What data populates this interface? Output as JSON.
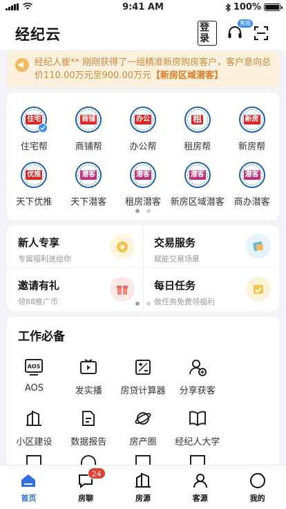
{
  "status_bar": {
    "time": "9:41 AM",
    "battery": "100%"
  },
  "header": {
    "title": "经纪云",
    "login_label": "登录",
    "kefu_badge": "客服"
  },
  "notice": {
    "text_prefix": "经纪人崔** 刚刚获得了一组精准新房购房客户，客户意向总价",
    "price": "110.00万元至900.00万元",
    "highlight": "【新房区域潜客】"
  },
  "services_grid": {
    "items": [
      {
        "label": "住宅帮",
        "logo_text": "住宅",
        "verified": true
      },
      {
        "label": "商铺帮",
        "logo_text": "商铺"
      },
      {
        "label": "办公帮",
        "logo_text": "办公"
      },
      {
        "label": "租房帮",
        "logo_text": "租"
      },
      {
        "label": "新房帮",
        "logo_text": "新房"
      },
      {
        "label": "天下优推",
        "logo_text": "优推"
      },
      {
        "label": "天下潜客",
        "logo_text": "潜客"
      },
      {
        "label": "租房潜客",
        "logo_text": "潜客"
      },
      {
        "label": "新房区域潜客",
        "logo_text": "潜客"
      },
      {
        "label": "商办潜客",
        "logo_text": "潜客"
      }
    ],
    "page_count": 2,
    "active_page": 1
  },
  "promo_tiles": [
    {
      "title": "新人专享",
      "subtitle": "专属福利送给你"
    },
    {
      "title": "交易服务",
      "subtitle": "赋能交易场景"
    },
    {
      "title": "邀请有礼",
      "subtitle": "领88推广币"
    },
    {
      "title": "每日任务",
      "subtitle": "做任务免费领福利"
    }
  ],
  "tools": {
    "title": "工作必备",
    "items": [
      {
        "label": "AOS",
        "icon": "aos-icon"
      },
      {
        "label": "发实播",
        "icon": "video-icon"
      },
      {
        "label": "房贷计算器",
        "icon": "calculator-icon"
      },
      {
        "label": "分享获客",
        "icon": "add-user-icon"
      },
      {
        "label": "小区建设",
        "icon": "building-icon"
      },
      {
        "label": "数据报告",
        "icon": "report-icon"
      },
      {
        "label": "房产圈",
        "icon": "planet-icon"
      },
      {
        "label": "经纪人大学",
        "icon": "book-icon"
      }
    ]
  },
  "tabbar": {
    "tabs": [
      {
        "label": "首页",
        "icon": "home-icon",
        "active": true
      },
      {
        "label": "房聊",
        "icon": "chat-icon",
        "badge": "24"
      },
      {
        "label": "房源",
        "icon": "house-icon"
      },
      {
        "label": "客源",
        "icon": "person-icon"
      },
      {
        "label": "我的",
        "icon": "profile-icon"
      }
    ]
  },
  "colors": {
    "accent": "#2f6fe0",
    "notice_bg": "#fdf0dd",
    "badge_red": "#e63b2e",
    "logo_blue": "#1d5fb7"
  }
}
